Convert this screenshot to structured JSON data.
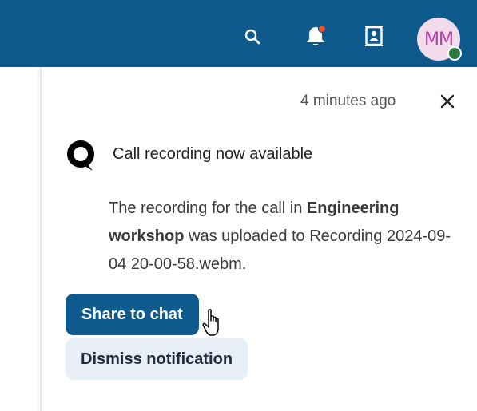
{
  "topbar": {
    "icons": {
      "search": "search-icon",
      "notifications": "bell-icon",
      "contacts": "contacts-icon"
    },
    "avatar": {
      "initials": "MM",
      "status": "online",
      "status_color": "#2d7b41"
    },
    "background": "#0f5a8c",
    "notification_dot_color": "#e9542f"
  },
  "notification": {
    "timestamp": "4 minutes ago",
    "close_icon": "close-icon",
    "app_icon": "talk-app-icon",
    "title": "Call recording now available",
    "body": {
      "prefix": "The recording for the call in ",
      "conversation": "Engineering workshop",
      "middle": " was uploaded to ",
      "filename": "Recording 2024-09-04 20-00-58.webm."
    },
    "actions": {
      "primary": "Share to chat",
      "secondary": "Dismiss notification"
    }
  },
  "colors": {
    "primary": "#0f5a8c",
    "secondary_bg": "#e7eef5"
  }
}
